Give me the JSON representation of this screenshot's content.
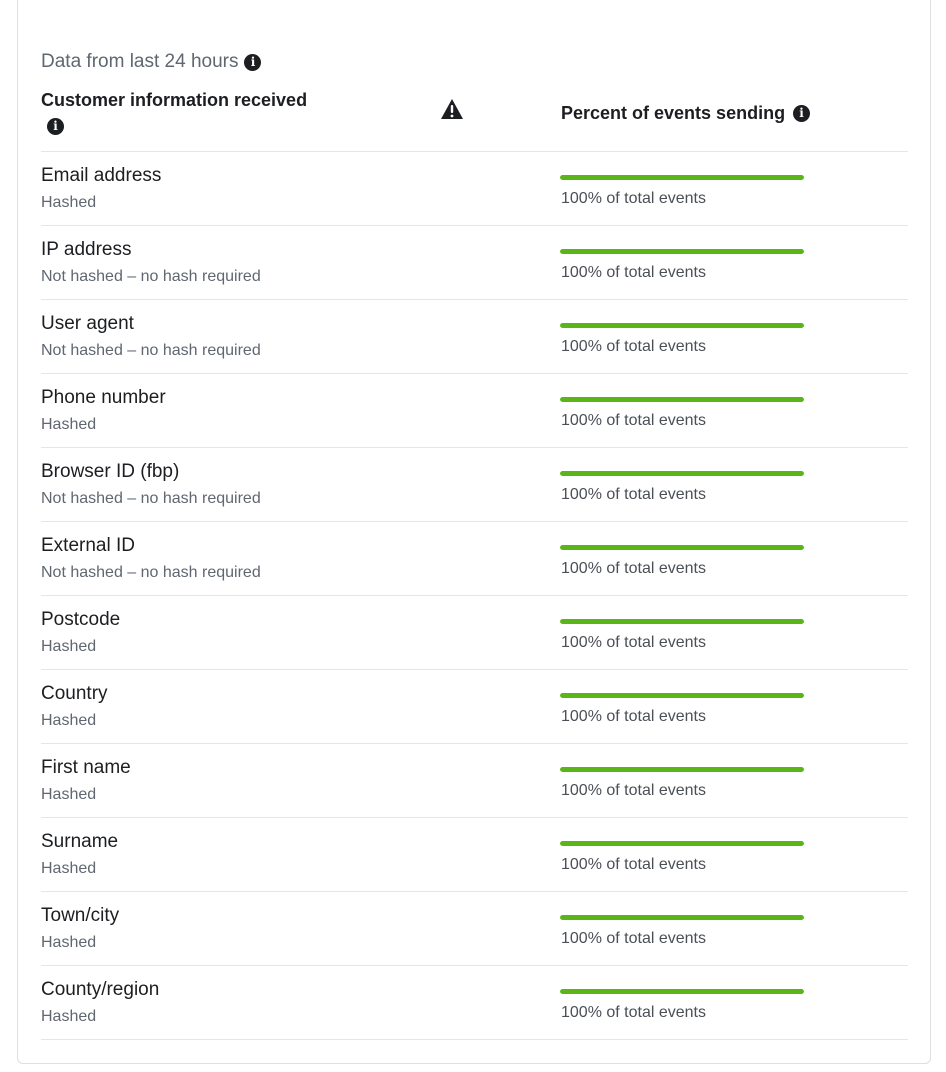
{
  "header": {
    "data_note": "Data from last 24 hours",
    "col_left": "Customer information received",
    "col_right": "Percent of events sending"
  },
  "colors": {
    "bar_fill": "#5ab516",
    "divider": "#e4e6eb"
  },
  "rows": [
    {
      "name": "Email address",
      "status": "Hashed",
      "percent": 1.0,
      "percent_label": "100% of total events"
    },
    {
      "name": "IP address",
      "status": "Not hashed – no hash required",
      "percent": 1.0,
      "percent_label": "100% of total events"
    },
    {
      "name": "User agent",
      "status": "Not hashed – no hash required",
      "percent": 1.0,
      "percent_label": "100% of total events"
    },
    {
      "name": "Phone number",
      "status": "Hashed",
      "percent": 1.0,
      "percent_label": "100% of total events"
    },
    {
      "name": "Browser ID (fbp)",
      "status": "Not hashed – no hash required",
      "percent": 1.0,
      "percent_label": "100% of total events"
    },
    {
      "name": "External ID",
      "status": "Not hashed – no hash required",
      "percent": 1.0,
      "percent_label": "100% of total events"
    },
    {
      "name": "Postcode",
      "status": "Hashed",
      "percent": 1.0,
      "percent_label": "100% of total events"
    },
    {
      "name": "Country",
      "status": "Hashed",
      "percent": 1.0,
      "percent_label": "100% of total events"
    },
    {
      "name": "First name",
      "status": "Hashed",
      "percent": 1.0,
      "percent_label": "100% of total events"
    },
    {
      "name": "Surname",
      "status": "Hashed",
      "percent": 1.0,
      "percent_label": "100% of total events"
    },
    {
      "name": "Town/city",
      "status": "Hashed",
      "percent": 1.0,
      "percent_label": "100% of total events"
    },
    {
      "name": "County/region",
      "status": "Hashed",
      "percent": 1.0,
      "percent_label": "100% of total events"
    }
  ]
}
